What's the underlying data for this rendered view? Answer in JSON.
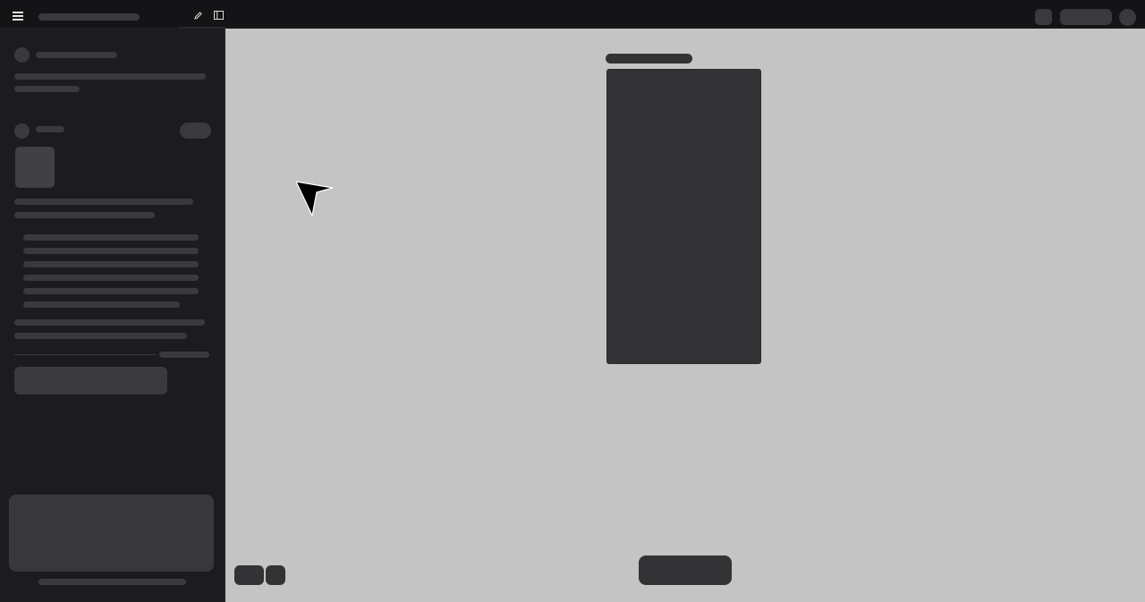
{
  "topbar": {
    "menu_icon": "hamburger-icon",
    "edit_icon": "pencil-icon",
    "panel_icon": "sidebar-panel-icon"
  },
  "colors": {
    "topbar_bg": "#141416",
    "sidebar_bg": "#1c1c1f",
    "canvas_bg": "#c4c4c4",
    "placeholder": "#3a3a3e",
    "dark_panel": "#333336"
  },
  "main": {
    "cursor_icon": "pointer-arrow-icon"
  }
}
